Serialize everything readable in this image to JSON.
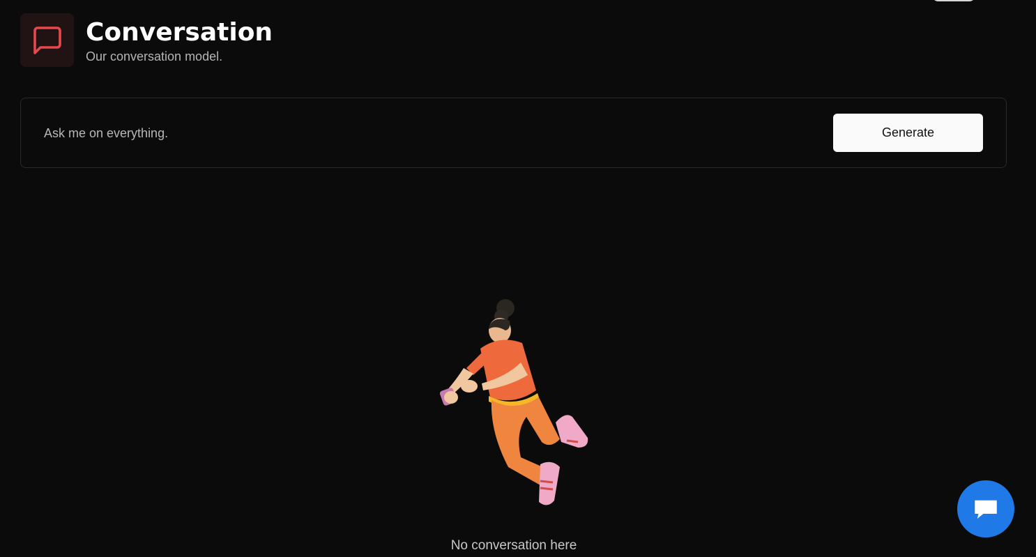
{
  "header": {
    "title": "Conversation",
    "subtitle": "Our conversation model.",
    "icon": "message-square-icon",
    "icon_color": "#e5484d"
  },
  "prompt": {
    "placeholder": "Ask me on everything.",
    "value": "",
    "generate_label": "Generate"
  },
  "empty_state": {
    "illustration": "person-with-phone-illustration",
    "message": "No conversation here"
  },
  "chat_widget": {
    "icon": "chat-bubble-icon",
    "color": "#1f7ae8"
  }
}
